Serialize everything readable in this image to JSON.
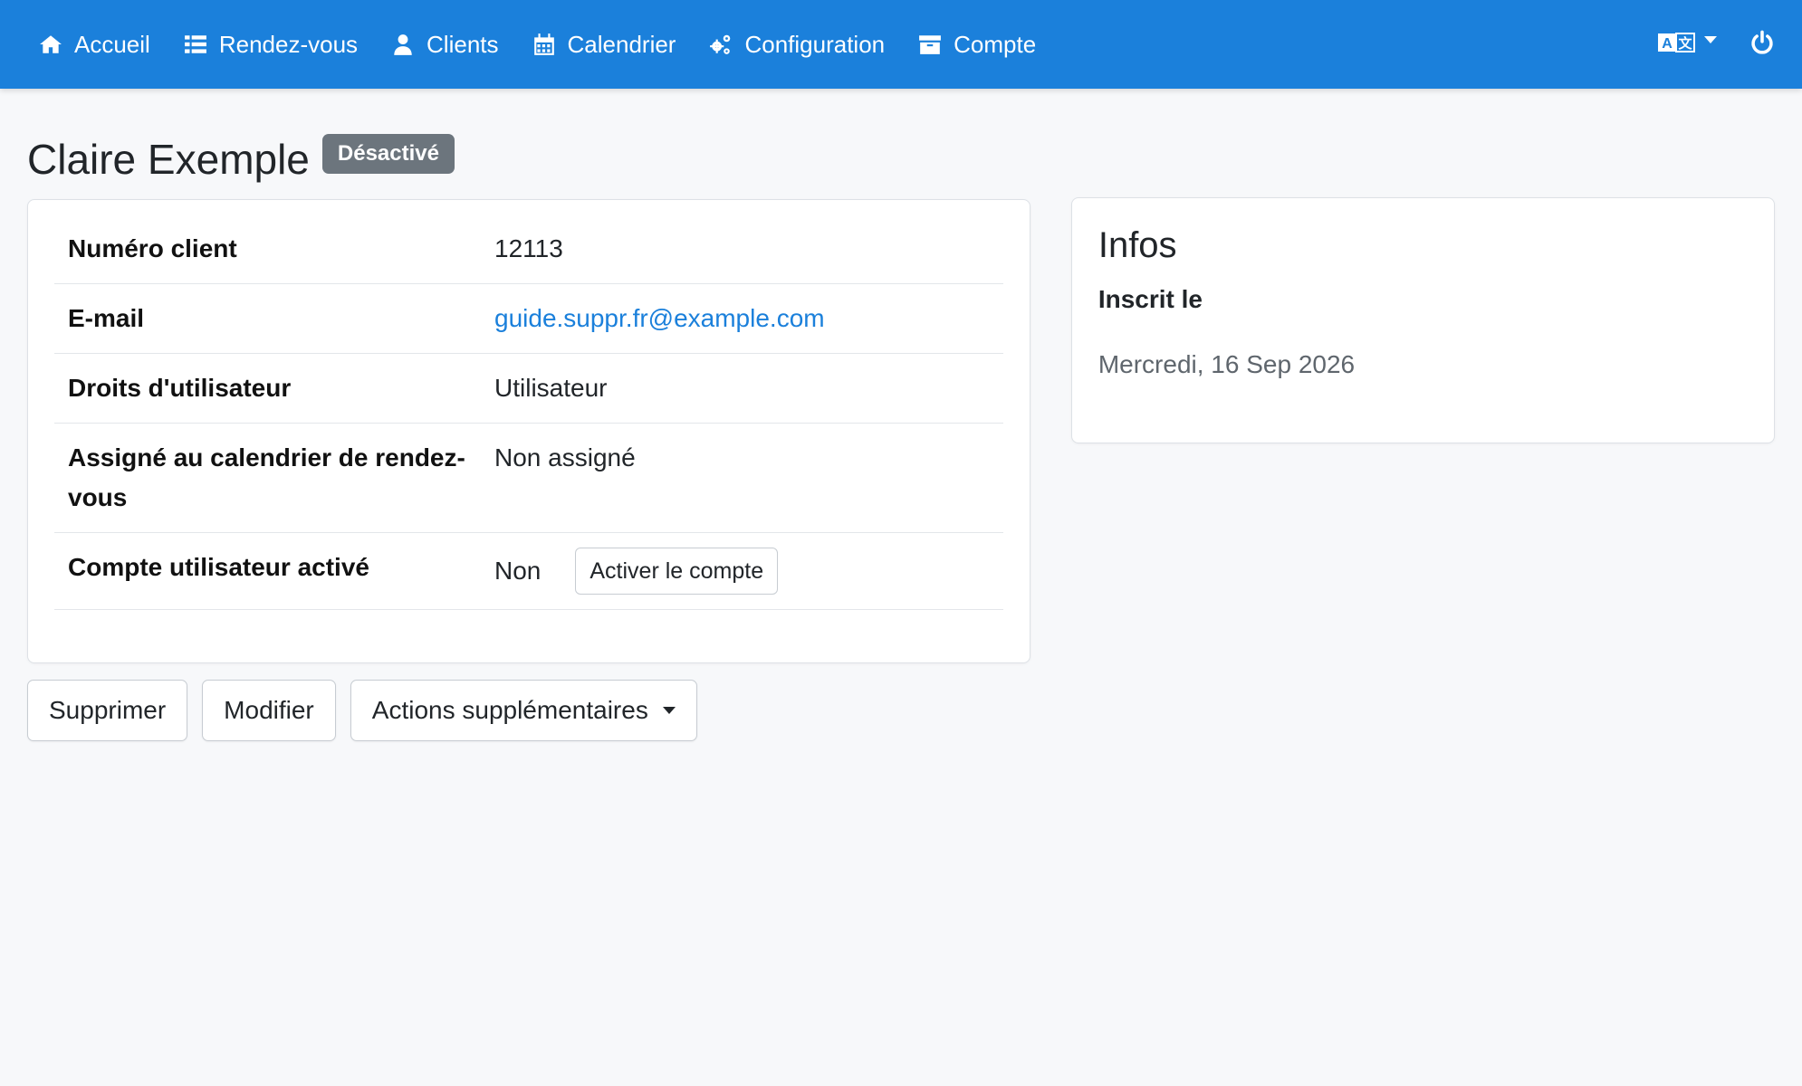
{
  "nav": {
    "items": [
      {
        "label": "Accueil",
        "icon": "home-icon"
      },
      {
        "label": "Rendez-vous",
        "icon": "list-icon"
      },
      {
        "label": "Clients",
        "icon": "user-icon"
      },
      {
        "label": "Calendrier",
        "icon": "calendar-icon"
      },
      {
        "label": "Configuration",
        "icon": "cogs-icon"
      },
      {
        "label": "Compte",
        "icon": "archive-icon"
      }
    ],
    "language_icon": "language-icon",
    "logout_icon": "power-icon",
    "color": "#1b80db"
  },
  "page": {
    "title": "Claire Exemple",
    "status_badge": "Désactivé"
  },
  "details": {
    "rows": [
      {
        "label": "Numéro client",
        "value": "12113"
      },
      {
        "label": "E-mail",
        "value": "guide.suppr.fr@example.com"
      },
      {
        "label": "Droits d'utilisateur",
        "value": "Utilisateur"
      },
      {
        "label": "Assigné au calendrier de rendez-vous",
        "value": "Non assigné"
      },
      {
        "label": "Compte utilisateur activé",
        "value": "Non",
        "button": "Activer le compte"
      }
    ]
  },
  "actions": {
    "delete": "Supprimer",
    "edit": "Modifier",
    "more": "Actions supplémentaires"
  },
  "infos": {
    "title": "Infos",
    "registered_label": "Inscrit le",
    "registered_value": "Mercredi, 16 Sep 2026"
  }
}
